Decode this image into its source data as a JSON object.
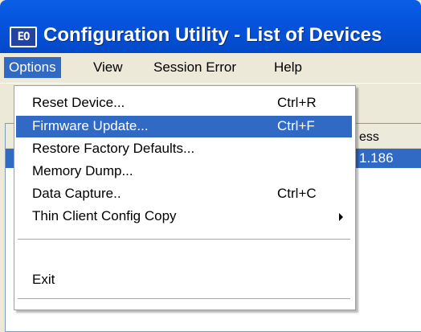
{
  "window": {
    "title": "Configuration Utility - List of Devices",
    "icon_text": "EO",
    "icon": "app-icon",
    "title_bar_color": "#0a5fe6"
  },
  "menubar": {
    "items": [
      {
        "label": "Options"
      },
      {
        "label": "View"
      },
      {
        "label": "Session Error"
      },
      {
        "label": "Help"
      }
    ],
    "open_item": "Options"
  },
  "device_list": {
    "column_header_partial": "ess",
    "selected_row_text_partial": "1.186",
    "selection_color": "#316ac5"
  },
  "options_menu": {
    "items": [
      {
        "label": "Reset Device...",
        "shortcut": "Ctrl+R"
      },
      {
        "label": "Firmware Update...",
        "shortcut": "Ctrl+F"
      },
      {
        "label": "Restore Factory Defaults...",
        "shortcut": ""
      },
      {
        "label": "Memory Dump...",
        "shortcut": ""
      },
      {
        "label": "Data Capture..",
        "shortcut": "Ctrl+C"
      },
      {
        "label": "Thin Client Config Copy",
        "shortcut": "",
        "submenu_icon": "chevron-right-icon"
      },
      {
        "label": "Exit",
        "shortcut": ""
      }
    ],
    "highlighted_item": "Firmware Update...",
    "highlight_color": "#316ac5"
  }
}
